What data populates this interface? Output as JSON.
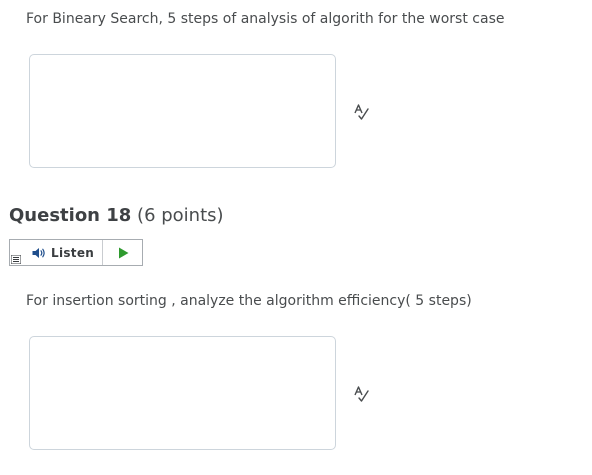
{
  "question17": {
    "prompt": "For  Bineary Search,  5 steps of analysis of algorith for the worst case"
  },
  "question18": {
    "title": "Question 18",
    "points": "(6 points)",
    "prompt": "For  insertion sorting , analyze the algorithm efficiency( 5 steps)"
  },
  "listen_widget": {
    "label": "Listen",
    "icons": [
      "menu-icon",
      "speaker-icon",
      "play-icon"
    ]
  },
  "answer_box_icon": "spellcheck-icon",
  "colors": {
    "text": "#494c4e",
    "box_border": "#cdd5dc",
    "play_green": "#2e9a2e",
    "speaker_blue": "#1f4e8c"
  }
}
